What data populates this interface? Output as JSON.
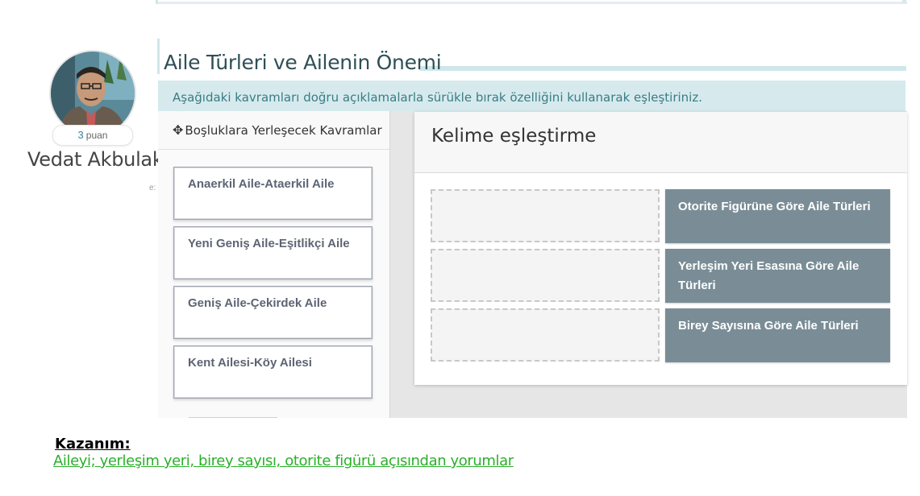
{
  "profile": {
    "points": "3",
    "points_unit": "puan",
    "name": "Vedat Akbulak",
    "cut_text": "e:"
  },
  "activity": {
    "title": "Aile Türleri ve Ailenin Önemi",
    "instruction": "Aşağıdaki kavramları doğru açıklamalarla sürükle bırak özelliğini kullanarak eşleştiriniz."
  },
  "left_panel": {
    "icon": "move-icon",
    "header": "Boşluklara Yerleşecek Kavramlar",
    "concepts": [
      "Anaerkil Aile-Ataerkil Aile",
      "Yeni Geniş Aile-Eşitlikçi Aile",
      "Geniş Aile-Çekirdek Aile",
      "Kent Ailesi-Köy Ailesi"
    ]
  },
  "right_panel": {
    "header": "Kelime eşleştirme",
    "targets": [
      "Otorite Figürüne Göre Aile Türleri",
      "Yerleşim Yeri Esasına Göre Aile Türleri",
      "Birey Sayısına Göre Aile Türleri"
    ]
  },
  "outcome": {
    "label": "Kazanım:",
    "text": "Aileyi; yerleşim yeri, birey sayısı, otorite figürü açısından yorumlar"
  },
  "colors": {
    "accent": "#cfe7ea",
    "instruction_bg": "#d6eaed",
    "target_card": "#7a8d96",
    "outcome_link": "#2ab02a"
  }
}
